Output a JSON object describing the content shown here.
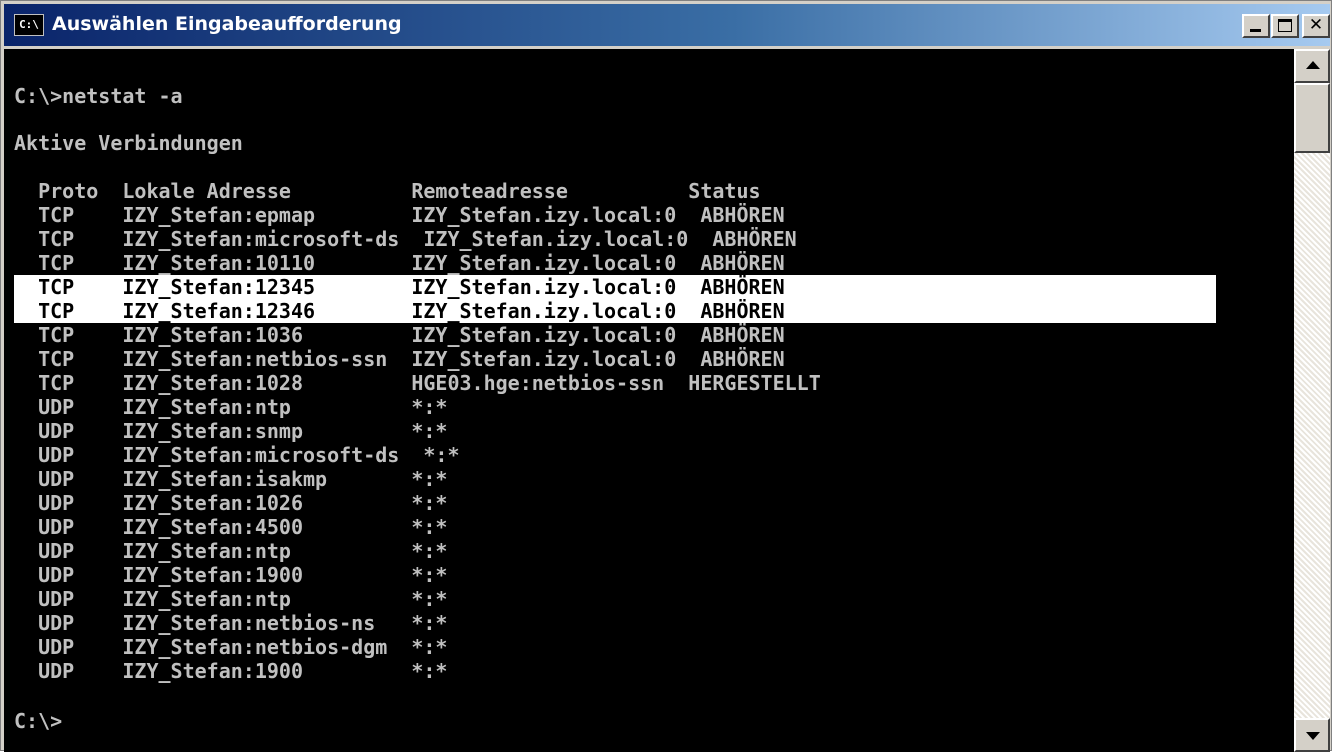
{
  "window": {
    "title": "Auswählen Eingabeaufforderung",
    "icon_text": "C:\\",
    "close_glyph": "✕"
  },
  "console": {
    "command_line": "C:\\>netstat -a",
    "section_title": "Aktive Verbindungen",
    "header": "  Proto  Lokale Adresse          Remoteadresse          Status",
    "rows": [
      "  TCP    IZY_Stefan:epmap        IZY_Stefan.izy.local:0  ABHÖREN",
      "  TCP    IZY_Stefan:microsoft-ds  IZY_Stefan.izy.local:0  ABHÖREN",
      "  TCP    IZY_Stefan:10110        IZY_Stefan.izy.local:0  ABHÖREN",
      "  TCP    IZY_Stefan:12345        IZY_Stefan.izy.local:0  ABHÖREN",
      "  TCP    IZY_Stefan:12346        IZY_Stefan.izy.local:0  ABHÖREN",
      "  TCP    IZY_Stefan:1036         IZY_Stefan.izy.local:0  ABHÖREN",
      "  TCP    IZY_Stefan:netbios-ssn  IZY_Stefan.izy.local:0  ABHÖREN",
      "  TCP    IZY_Stefan:1028         HGE03.hge:netbios-ssn  HERGESTELLT",
      "  UDP    IZY_Stefan:ntp          *:*",
      "  UDP    IZY_Stefan:snmp         *:*",
      "  UDP    IZY_Stefan:microsoft-ds  *:*",
      "  UDP    IZY_Stefan:isakmp       *:*",
      "  UDP    IZY_Stefan:1026         *:*",
      "  UDP    IZY_Stefan:4500         *:*",
      "  UDP    IZY_Stefan:ntp          *:*",
      "  UDP    IZY_Stefan:1900         *:*",
      "  UDP    IZY_Stefan:ntp          *:*",
      "  UDP    IZY_Stefan:netbios-ns   *:*",
      "  UDP    IZY_Stefan:netbios-dgm  *:*",
      "  UDP    IZY_Stefan:1900         *:*"
    ],
    "highlighted_rows": [
      3,
      4
    ],
    "final_prompt": "C:\\>"
  },
  "colors": {
    "console_bg": "#000000",
    "console_text": "#c0c0c0",
    "selection_bg": "#ffffff",
    "titlebar_start": "#0a246a"
  }
}
